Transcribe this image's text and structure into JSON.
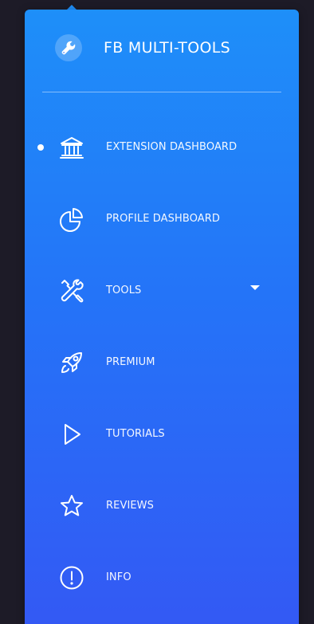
{
  "brand": {
    "title": "FB MULTI-TOOLS",
    "icon": "wrench-icon"
  },
  "nav": {
    "active_index": 0,
    "items": [
      {
        "label": "EXTENSION DASHBOARD",
        "icon": "bank-icon",
        "active": true
      },
      {
        "label": "PROFILE DASHBOARD",
        "icon": "pie-chart-icon",
        "active": false
      },
      {
        "label": "TOOLS",
        "icon": "tools-icon",
        "active": false,
        "has_submenu": true
      },
      {
        "label": "PREMIUM",
        "icon": "rocket-icon",
        "active": false
      },
      {
        "label": "TUTORIALS",
        "icon": "play-icon",
        "active": false
      },
      {
        "label": "REVIEWS",
        "icon": "star-icon",
        "active": false
      },
      {
        "label": "INFO",
        "icon": "info-icon",
        "active": false
      }
    ]
  },
  "colors": {
    "panel_top": "#1e8ff9",
    "panel_bottom": "#3458f4",
    "background": "#1d1b27",
    "text": "#ffffff"
  }
}
